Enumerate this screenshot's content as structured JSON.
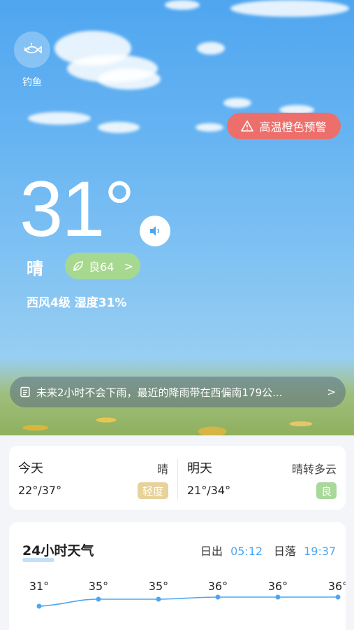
{
  "fishing": {
    "label": "钓鱼",
    "icon": "fish-icon"
  },
  "alert": {
    "label": "高温橙色预警",
    "icon": "warning-icon",
    "color": "#ec6f6b"
  },
  "current": {
    "temperature": "31°",
    "condition": "晴",
    "aqi_label": "良64",
    "aqi_arrow": ">",
    "wind_humidity": "西风4级 湿度31%"
  },
  "rain_notice": {
    "text": "未来2小时不会下雨，最近的降雨带在西偏南179公...",
    "arrow": ">"
  },
  "days": [
    {
      "name": "今天",
      "condition": "晴",
      "range": "22°/37°",
      "badge": "轻度"
    },
    {
      "name": "明天",
      "condition": "晴转多云",
      "range": "21°/34°",
      "badge": "良"
    }
  ],
  "hourly": {
    "title": "24小时天气",
    "sunrise_label": "日出",
    "sunrise": "05:12",
    "sunset_label": "日落",
    "sunset": "19:37",
    "temps": [
      "31°",
      "35°",
      "35°",
      "36°",
      "36°",
      "36°"
    ]
  },
  "colors": {
    "accent": "#4fa6ef",
    "aqi_good": "#a6d98f",
    "badge_mild": "#e7d29a",
    "badge_good": "#a8d89a"
  }
}
